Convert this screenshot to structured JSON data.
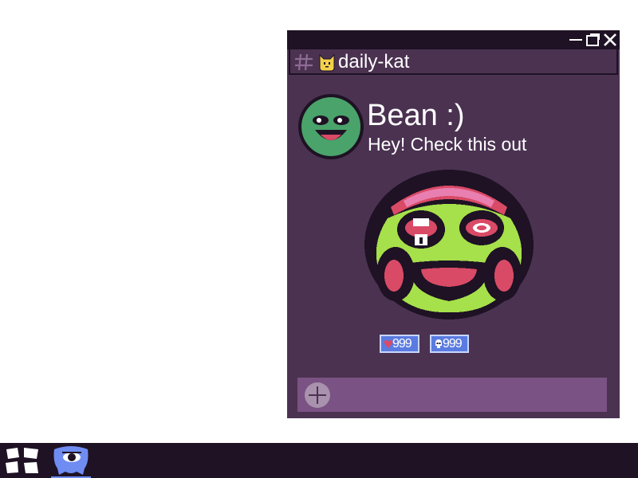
{
  "window": {
    "controls": {
      "minimize": "minimize-icon",
      "maximize": "maximize-icon",
      "close": "close-icon"
    }
  },
  "channel": {
    "icon": "hash-icon",
    "emoji": "cat-icon",
    "name": "daily-kat"
  },
  "message": {
    "author": "Bean :)",
    "text": "Hey! Check this out",
    "avatar": "green-smiley-avatar",
    "attachment": "zombie-face-image"
  },
  "reactions": [
    {
      "icon": "heart-icon",
      "count": "999"
    },
    {
      "icon": "skull-icon",
      "count": "999"
    }
  ],
  "compose": {
    "placeholder": "",
    "add_icon": "plus-icon"
  },
  "taskbar": {
    "start_icon": "start-menu-icon",
    "app_icon": "chat-app-icon"
  },
  "colors": {
    "window_bg": "#4b3251",
    "titlebar_bg": "#1e1224",
    "compose_bg": "#7a5283",
    "reaction_bg": "#5a7be0",
    "taskbar_bg": "#1e1224",
    "accent": "#6f8cf2"
  }
}
